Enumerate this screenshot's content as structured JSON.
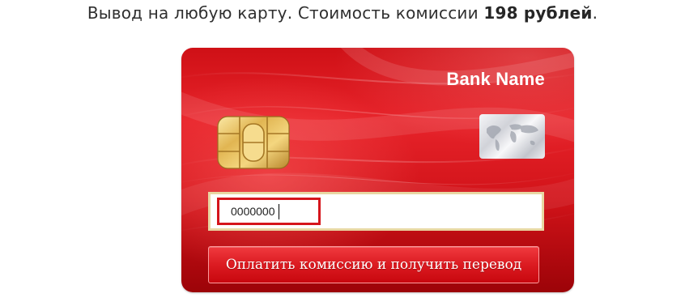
{
  "headline": {
    "text": "Вывод на любую карту. Стоимость комиссии ",
    "fee": "198 рублей",
    "end": "."
  },
  "card": {
    "bank_name": "Bank Name",
    "chip_icon": "sim-chip-icon",
    "hologram_icon": "world-map-hologram-icon",
    "input_value": "0000000",
    "input_highlight_color": "#d5151c",
    "pay_button_label": "Оплатить комиссию и получить перевод",
    "card_color": "#e01f26"
  }
}
